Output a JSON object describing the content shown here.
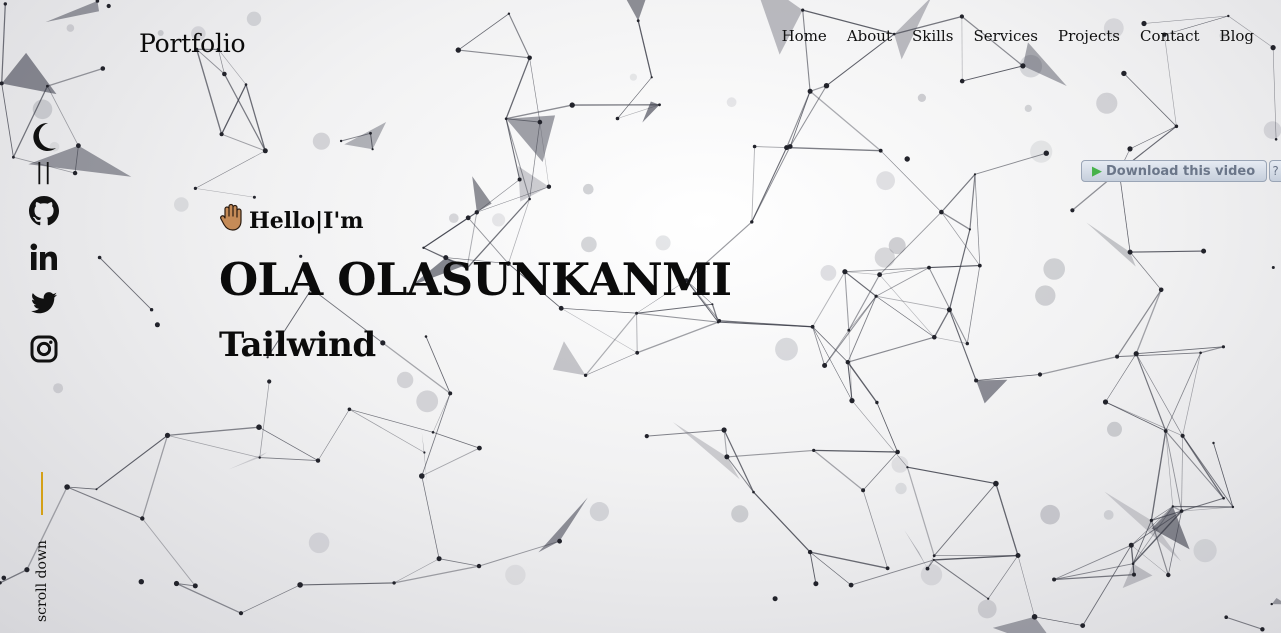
{
  "header": {
    "logo": "Portfolio",
    "nav": [
      "Home",
      "About",
      "Skills",
      "Services",
      "Projects",
      "Contact",
      "Blog"
    ]
  },
  "sidebar": {
    "separator": "||",
    "icons": [
      "moon-icon",
      "github-icon",
      "linkedin-icon",
      "twitter-icon",
      "instagram-icon"
    ],
    "scroll_label": "scroll down",
    "accent": "#d4a017"
  },
  "hero": {
    "greeting": "Hello|I'm",
    "name": "OLA OLASUNKANMI",
    "role": "Tailwind"
  },
  "video_overlay": {
    "download_label": "Download this video",
    "help_label": "?"
  }
}
